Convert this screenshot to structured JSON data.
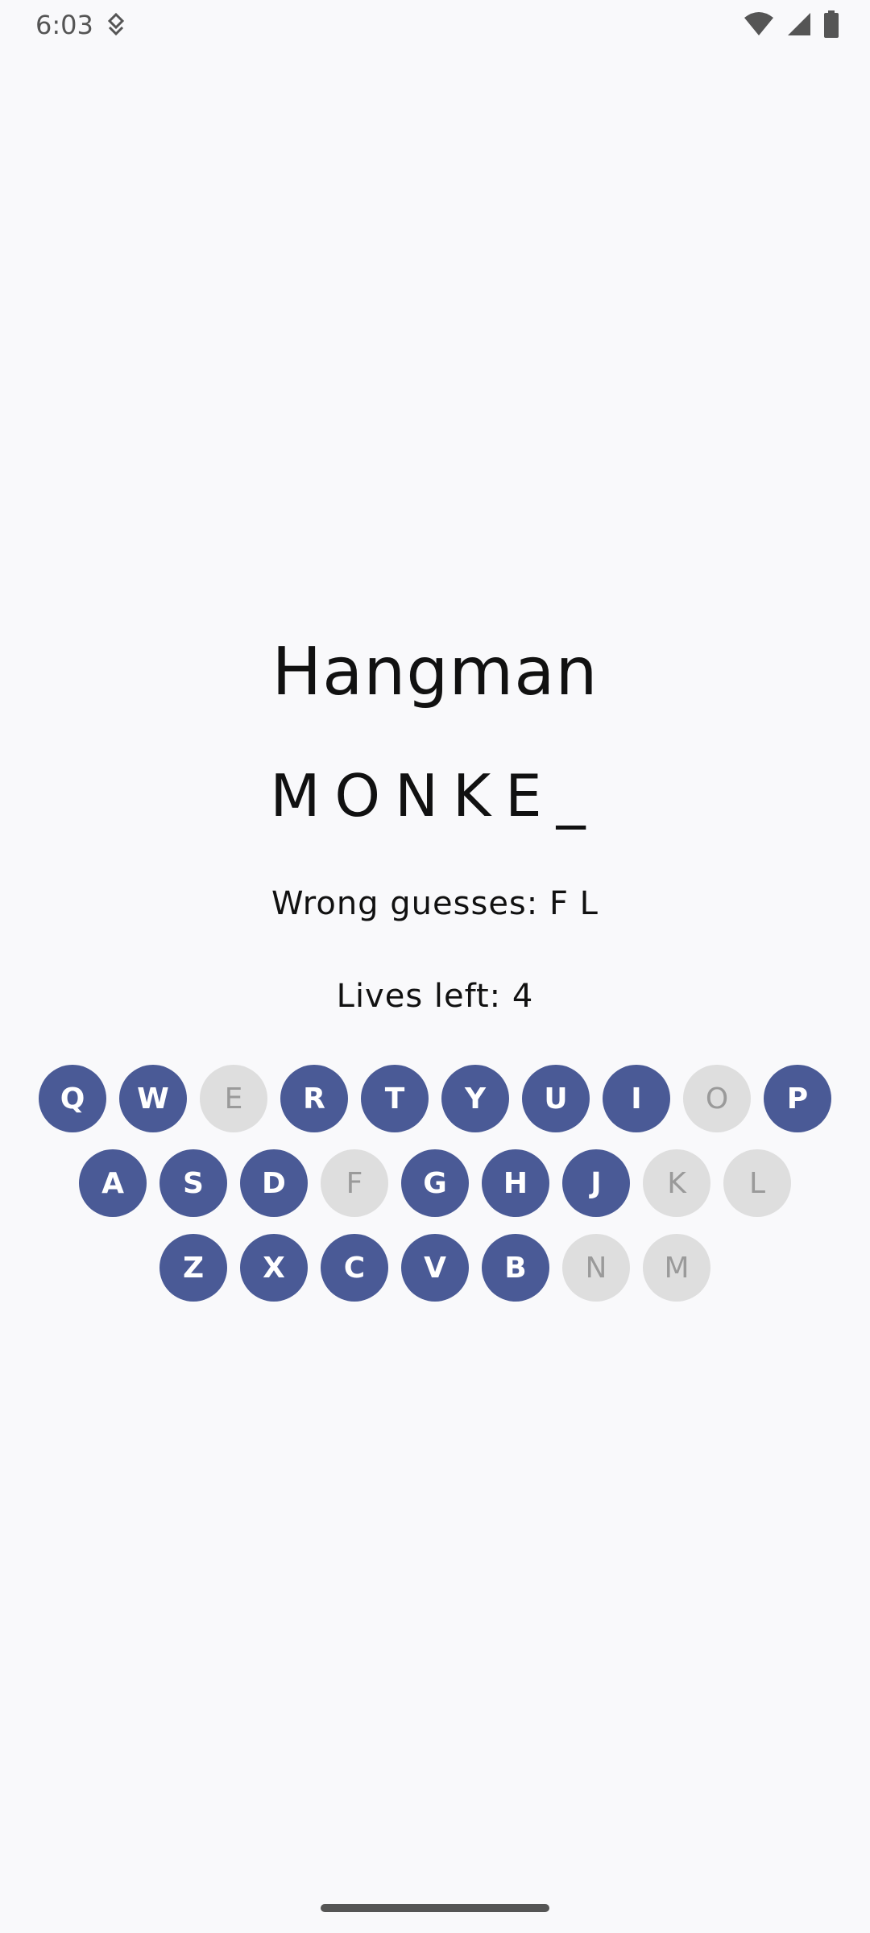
{
  "status_bar": {
    "time": "6:03"
  },
  "main": {
    "title": "Hangman",
    "word_display": "MONKE_",
    "wrong_guesses": "Wrong guesses: F L",
    "lives_left": "Lives left: 4"
  },
  "keyboard": {
    "row1": [
      {
        "letter": "Q",
        "used": false
      },
      {
        "letter": "W",
        "used": false
      },
      {
        "letter": "E",
        "used": true
      },
      {
        "letter": "R",
        "used": false
      },
      {
        "letter": "T",
        "used": false
      },
      {
        "letter": "Y",
        "used": false
      },
      {
        "letter": "U",
        "used": false
      },
      {
        "letter": "I",
        "used": false
      },
      {
        "letter": "O",
        "used": true
      },
      {
        "letter": "P",
        "used": false
      }
    ],
    "row2": [
      {
        "letter": "A",
        "used": false
      },
      {
        "letter": "S",
        "used": false
      },
      {
        "letter": "D",
        "used": false
      },
      {
        "letter": "F",
        "used": true
      },
      {
        "letter": "G",
        "used": false
      },
      {
        "letter": "H",
        "used": false
      },
      {
        "letter": "J",
        "used": false
      },
      {
        "letter": "K",
        "used": true
      },
      {
        "letter": "L",
        "used": true
      }
    ],
    "row3": [
      {
        "letter": "Z",
        "used": false
      },
      {
        "letter": "X",
        "used": false
      },
      {
        "letter": "C",
        "used": false
      },
      {
        "letter": "V",
        "used": false
      },
      {
        "letter": "B",
        "used": false
      },
      {
        "letter": "N",
        "used": true
      },
      {
        "letter": "M",
        "used": true
      }
    ]
  },
  "colors": {
    "key_active": "#4a5a96",
    "key_used": "#dedede",
    "background": "#f9f9fb"
  }
}
